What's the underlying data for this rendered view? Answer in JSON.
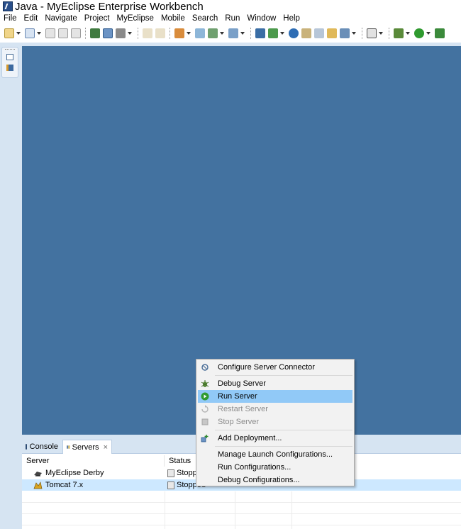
{
  "window": {
    "title": "Java - MyEclipse Enterprise Workbench"
  },
  "menubar": {
    "items": [
      "File",
      "Edit",
      "Navigate",
      "Project",
      "MyEclipse",
      "Mobile",
      "Search",
      "Run",
      "Window",
      "Help"
    ]
  },
  "panel": {
    "tabs": [
      {
        "label": "Console",
        "icon": "console-icon"
      },
      {
        "label": "Servers",
        "icon": "servers-icon",
        "active": true
      }
    ],
    "close_glyph": "×",
    "columns": [
      "Server",
      "Status"
    ],
    "rows": [
      {
        "server": "MyEclipse Derby",
        "status": "Stopp",
        "icon": "derby-icon"
      },
      {
        "server": "Tomcat  7.x",
        "status": "Stopped",
        "icon": "tomcat-icon",
        "selected": true
      }
    ]
  },
  "context_menu": {
    "items": [
      {
        "label": "Configure Server Connector",
        "icon": "connector-icon"
      },
      {
        "label": "Debug Server",
        "icon": "bug-icon"
      },
      {
        "label": "Run Server",
        "icon": "run-icon",
        "selected": true
      },
      {
        "label": "Restart Server",
        "icon": "restart-icon",
        "disabled": true
      },
      {
        "label": "Stop Server",
        "icon": "stop-icon",
        "disabled": true
      },
      {
        "label": "Add Deployment...",
        "icon": "deploy-icon"
      },
      {
        "label": "Manage Launch Configurations..."
      },
      {
        "label": "Run Configurations..."
      },
      {
        "label": "Debug Configurations..."
      }
    ]
  },
  "colors": {
    "editor_bg": "#4372a0",
    "chrome_bg": "#d6e4f2",
    "menu_selection": "#91c9f7",
    "row_selection": "#cde8ff"
  }
}
